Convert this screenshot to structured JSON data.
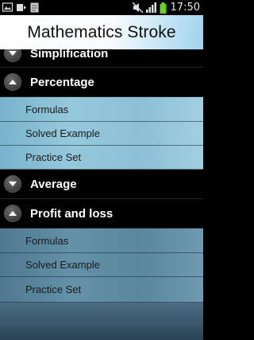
{
  "status_bar": {
    "time": "17:50",
    "icons": [
      "gallery-icon",
      "usb-icon",
      "note-icon",
      "mute-icon",
      "signal-icon",
      "battery-icon"
    ]
  },
  "app": {
    "title": "Mathematics Stroke"
  },
  "menu": {
    "groups": [
      {
        "label": "Simplification",
        "expanded": false
      },
      {
        "label": "Percentage",
        "expanded": true,
        "items": [
          "Formulas",
          "Solved Example",
          "Practice Set"
        ]
      },
      {
        "label": "Average",
        "expanded": false
      },
      {
        "label": "Profit and loss",
        "expanded": true,
        "items": [
          "Formulas",
          "Solved Example",
          "Practice Set"
        ]
      }
    ]
  },
  "colors": {
    "accent": "#9fd3ee",
    "battery": "#6ad11c",
    "group_bg": "#000000"
  }
}
